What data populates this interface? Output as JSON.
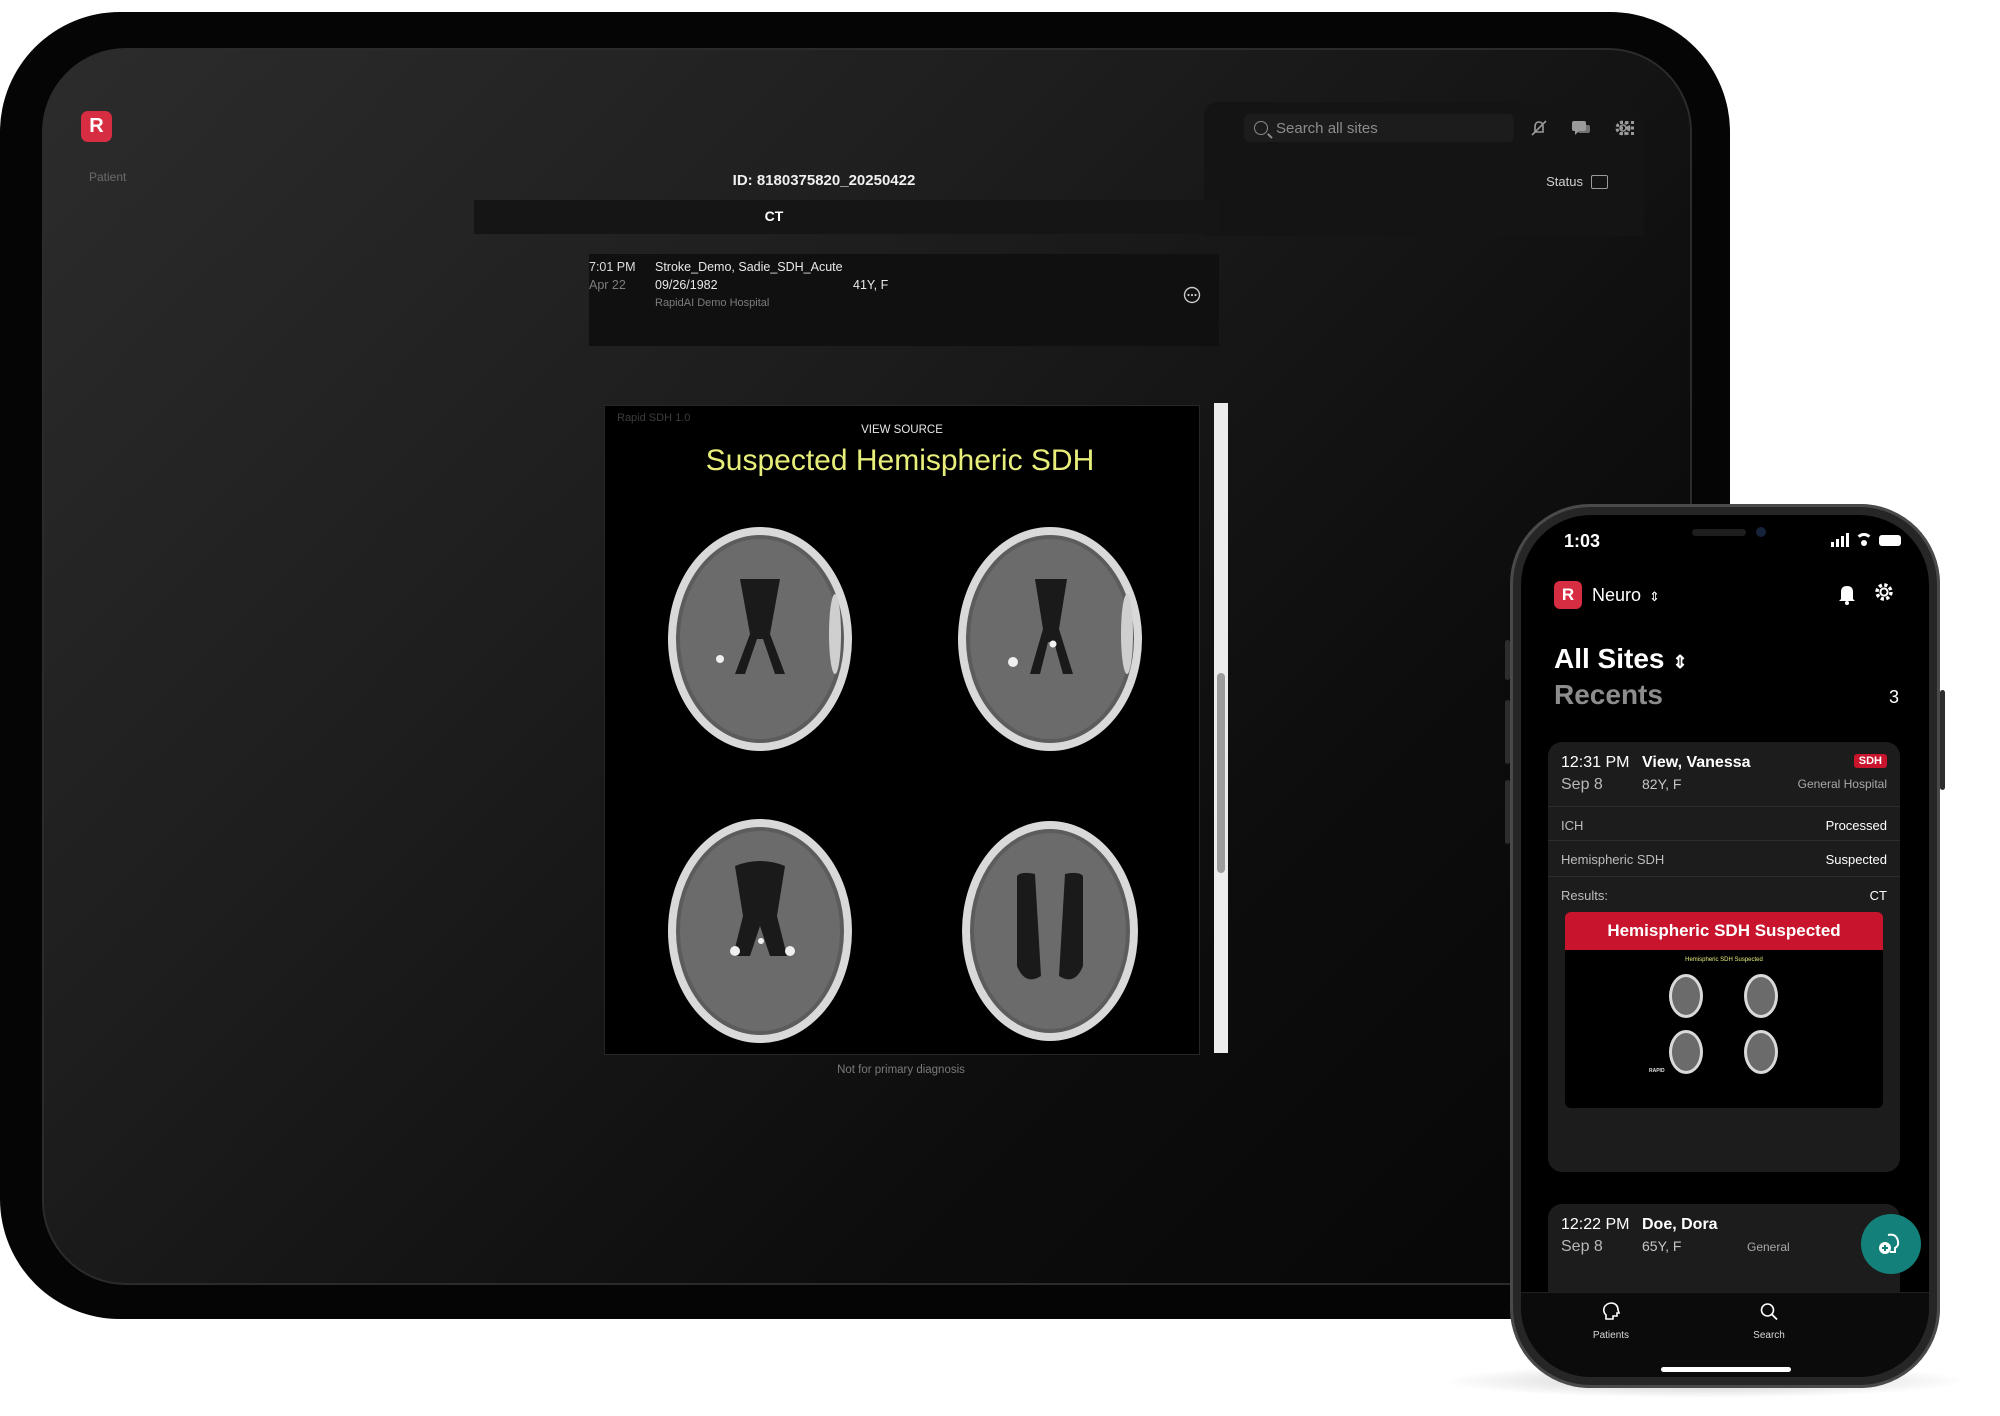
{
  "tablet": {
    "logo_letter": "R",
    "patient_label": "Patient",
    "search_placeholder": "Search all sites",
    "study_id": "ID: 8180375820_20250422",
    "status_label": "Status",
    "modality": "CT",
    "study": {
      "time": "7:01 PM",
      "date": "Apr 22",
      "name": "Stroke_Demo, Sadie_SDH_Acute",
      "dob": "09/26/1982",
      "age_sex": "41Y, F",
      "hospital": "RapidAI Demo Hospital"
    },
    "result": {
      "module": "Rapid SDH 1.0",
      "view_source": "VIEW SOURCE",
      "finding": "Suspected Hemispheric SDH"
    },
    "footer": "Not for primary diagnosis",
    "icons": [
      "search-icon",
      "mute-icon",
      "chat-icon",
      "gear-icon",
      "apps-grid-icon",
      "status-icon",
      "more-icon"
    ]
  },
  "phone": {
    "time": "1:03",
    "logo_letter": "R",
    "org": "Neuro",
    "site_scope": "All Sites",
    "section": "Recents",
    "count": "3",
    "cases": [
      {
        "time": "12:31 PM",
        "date": "Sep 8",
        "name": "View, Vanessa",
        "age_sex": "82Y, F",
        "hospital": "General Hospital",
        "badge": "SDH",
        "modules": [
          {
            "name": "ICH",
            "status": "Processed"
          },
          {
            "name": "Hemispheric SDH",
            "status": "Suspected"
          }
        ],
        "results_label": "Results:",
        "results_modality": "CT",
        "alert": "Hemispheric SDH Suspected",
        "thumb_title": "Hemispheric SDH Suspected",
        "thumb_brand": "RAPID"
      },
      {
        "time": "12:22 PM",
        "date": "Sep 8",
        "name": "Doe, Dora",
        "age_sex": "65Y, F",
        "hospital": "General"
      }
    ],
    "tabs": [
      {
        "label": "Patients",
        "icon": "head-icon"
      },
      {
        "label": "Search",
        "icon": "search-icon"
      }
    ],
    "colors": {
      "brand": "#d62d42",
      "alert": "#c8142c",
      "fab": "#14807a",
      "finding": "#e7ee7a"
    }
  }
}
